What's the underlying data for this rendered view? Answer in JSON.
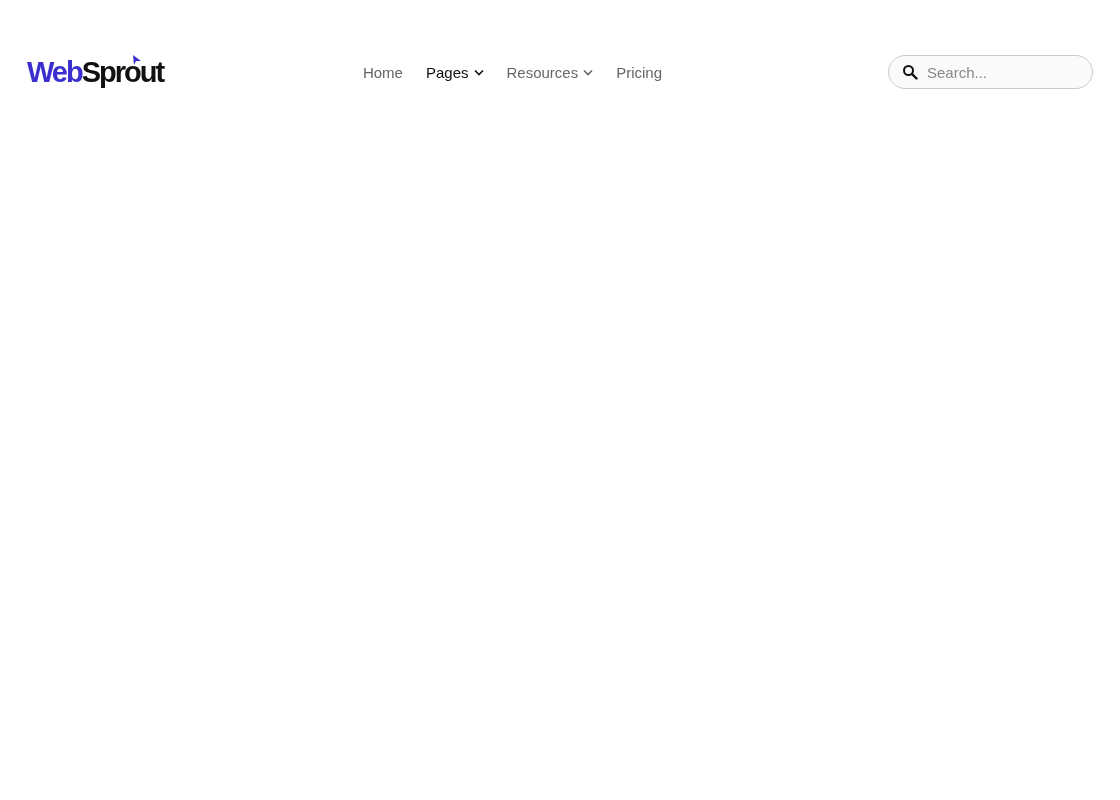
{
  "logo": {
    "parts": [
      {
        "text": "Web",
        "color": "#3b2fd0"
      },
      {
        "text": "Sprout",
        "color": "#111111"
      }
    ]
  },
  "nav": [
    {
      "label": "Home",
      "selected": false,
      "dropdown": false
    },
    {
      "label": "Pages",
      "selected": true,
      "dropdown": true
    },
    {
      "label": "Resources",
      "selected": false,
      "dropdown": true
    },
    {
      "label": "Pricing",
      "selected": false,
      "dropdown": false
    }
  ],
  "search": {
    "placeholder": "Search..."
  }
}
